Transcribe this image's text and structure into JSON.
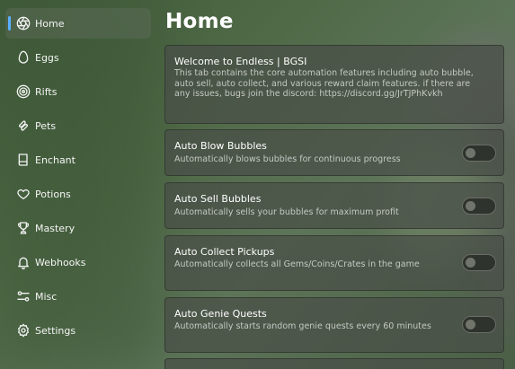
{
  "sidebar": {
    "items": [
      {
        "label": "Home",
        "icon": "aperture-icon",
        "active": true
      },
      {
        "label": "Eggs",
        "icon": "egg-icon"
      },
      {
        "label": "Rifts",
        "icon": "target-icon"
      },
      {
        "label": "Pets",
        "icon": "bone-icon"
      },
      {
        "label": "Enchant",
        "icon": "book-icon"
      },
      {
        "label": "Potions",
        "icon": "heart-icon"
      },
      {
        "label": "Mastery",
        "icon": "trophy-icon"
      },
      {
        "label": "Webhooks",
        "icon": "bell-icon"
      },
      {
        "label": "Misc",
        "icon": "sliders-icon"
      },
      {
        "label": "Settings",
        "icon": "gear-icon"
      }
    ],
    "indicator_color": "#5ab0ff"
  },
  "main": {
    "title": "Home",
    "welcome": {
      "title": "Welcome to Endless | BGSI",
      "description": "This tab contains the core automation features including auto bubble, auto sell, auto collect, and various reward claim features. if there are any issues, bugs join the discord: https://discord.gg/JrTJPhKvkh"
    },
    "toggles": [
      {
        "title": "Auto Blow Bubbles",
        "description": "Automatically blows bubbles for continuous progress",
        "enabled": false
      },
      {
        "title": "Auto Sell Bubbles",
        "description": "Automatically sells your bubbles for maximum profit",
        "enabled": false
      },
      {
        "title": "Auto Collect Pickups",
        "description": "Automatically collects all Gems/Coins/Crates in the game",
        "enabled": false
      },
      {
        "title": "Auto Genie Quests",
        "description": "Automatically starts random genie quests every 60 minutes",
        "enabled": false
      }
    ]
  }
}
